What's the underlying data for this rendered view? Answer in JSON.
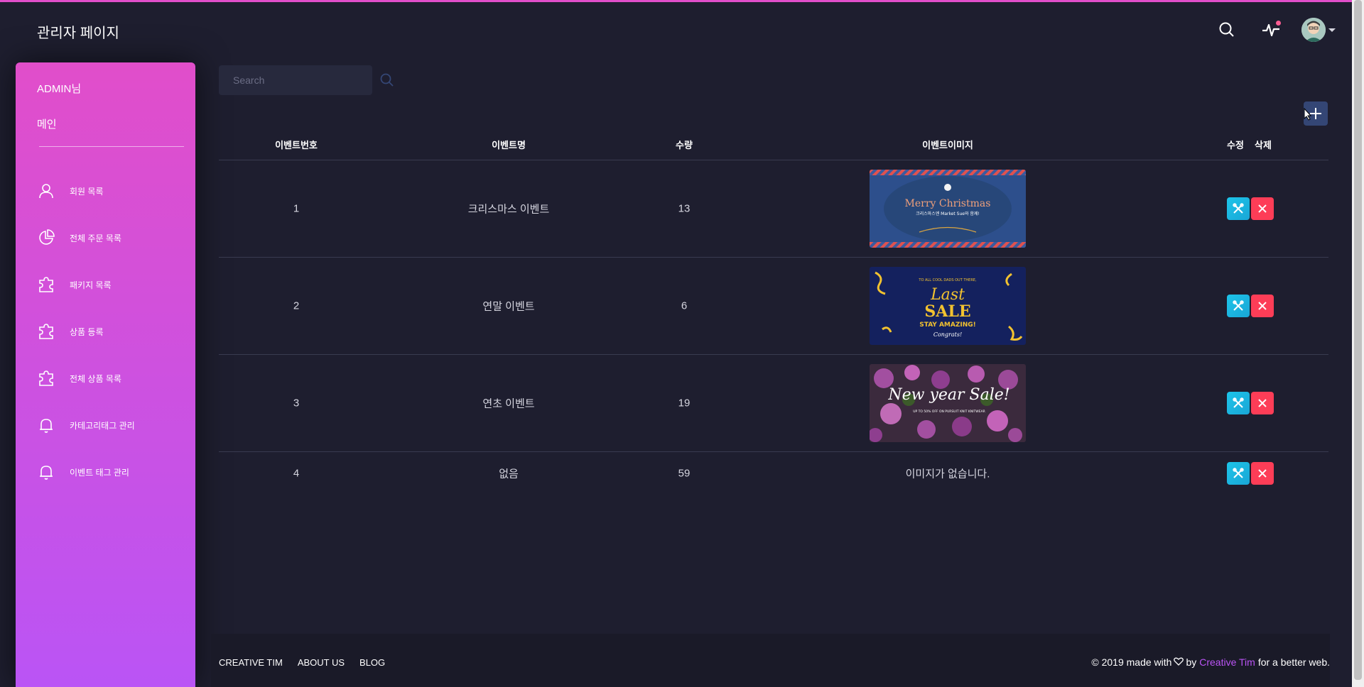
{
  "header": {
    "title": "관리자 페이지",
    "icons": [
      "search-icon",
      "pulse-icon",
      "avatar"
    ],
    "accent_color": "#e14eca"
  },
  "sidebar": {
    "user": "ADMIN님",
    "main": "메인",
    "items": [
      {
        "label": "회원 목록",
        "icon": "user-icon"
      },
      {
        "label": "전체 주문 목록",
        "icon": "pie-chart-icon"
      },
      {
        "label": "패키지 목록",
        "icon": "puzzle-icon"
      },
      {
        "label": "상품 등록",
        "icon": "puzzle-icon"
      },
      {
        "label": "전체 상품 목록",
        "icon": "puzzle-icon"
      },
      {
        "label": "카테고리태그 관리",
        "icon": "bell-icon"
      },
      {
        "label": "이벤트 태그 관리",
        "icon": "bell-icon"
      }
    ],
    "gradient": [
      "#e14eca",
      "#ba54f5"
    ]
  },
  "search": {
    "placeholder": "Search"
  },
  "table": {
    "headers": {
      "no": "이벤트번호",
      "name": "이벤트명",
      "qty": "수량",
      "image": "이벤트이미지",
      "edit": "수정",
      "delete": "삭제"
    },
    "rows": [
      {
        "no": "1",
        "name": "크리스마스 이벤트",
        "qty": "13",
        "image": {
          "title": "Merry Christmas",
          "subtitle": "크리스마스엔 Market Sue와 함께!"
        }
      },
      {
        "no": "2",
        "name": "연말 이벤트",
        "qty": "6",
        "image": {
          "top": "TO ALL COOL DADS OUT THERE,",
          "line1": "Last",
          "line2": "SALE",
          "line3": "STAY AMAZING!",
          "line4": "Congrats!"
        }
      },
      {
        "no": "3",
        "name": "연초 이벤트",
        "qty": "19",
        "image": {
          "title": "New year Sale!",
          "subtitle": "UP TO 50% OFF ON PURSUIT KNIT KNITWEAR"
        }
      },
      {
        "no": "4",
        "name": "없음",
        "qty": "59",
        "no_image": "이미지가 없습니다."
      }
    ],
    "colors": {
      "edit": "#1dc4e9",
      "delete": "#fd3d57"
    }
  },
  "footer": {
    "links": [
      "CREATIVE TIM",
      "ABOUT US",
      "BLOG"
    ],
    "copy_prefix": "© 2019 made with",
    "copy_by": "by",
    "brand": "Creative Tim",
    "copy_suffix": "for a better web."
  }
}
